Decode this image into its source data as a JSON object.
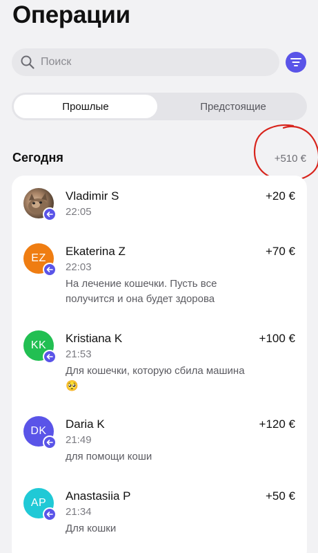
{
  "header": {
    "title": "Операции"
  },
  "search": {
    "placeholder": "Поиск"
  },
  "tabs": [
    {
      "label": "Прошлые",
      "active": true
    },
    {
      "label": "Предстоящие",
      "active": false
    }
  ],
  "section": {
    "title": "Сегодня",
    "total": "+510 €"
  },
  "colors": {
    "accent": "#5a54e8",
    "annotation": "#d8241c"
  },
  "transactions": [
    {
      "name": "Vladimir S",
      "time": "22:05",
      "comment": "",
      "amount": "+20 €",
      "avatar_initials": "",
      "avatar_color": "photo"
    },
    {
      "name": "Ekaterina Z",
      "time": "22:03",
      "comment": "На лечение кошечки. Пусть все получится и она будет здорова",
      "amount": "+70 €",
      "avatar_initials": "EZ",
      "avatar_color": "#ef7d12"
    },
    {
      "name": "Kristiana K",
      "time": "21:53",
      "comment": "Для кошечки, которую сбила машина 🥺",
      "amount": "+100 €",
      "avatar_initials": "KK",
      "avatar_color": "#22bf52"
    },
    {
      "name": "Daria K",
      "time": "21:49",
      "comment": "для  помощи коши",
      "amount": "+120 €",
      "avatar_initials": "DK",
      "avatar_color": "#5a54e8"
    },
    {
      "name": "Anastasiia P",
      "time": "21:34",
      "comment": "Для кошки",
      "amount": "+50 €",
      "avatar_initials": "AP",
      "avatar_color": "#20c9d6"
    }
  ]
}
